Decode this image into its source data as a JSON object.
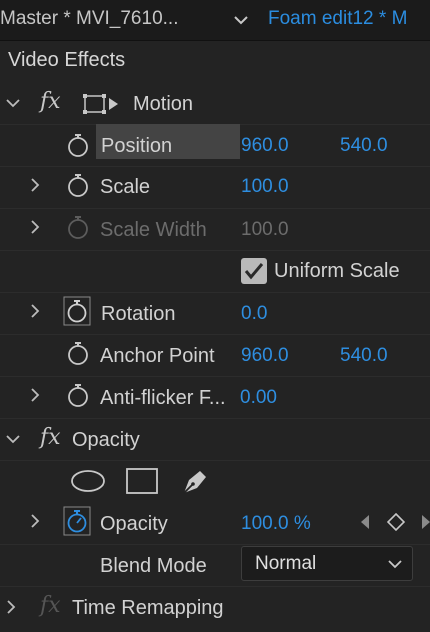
{
  "tabs": {
    "master": "Master * MVI_7610...",
    "sequence": "Foam edit12 * M"
  },
  "panel": {
    "section_title": "Video Effects"
  },
  "motion": {
    "name": "Motion",
    "fx_label": "fx",
    "position": {
      "label": "Position",
      "x": "960.0",
      "y": "540.0"
    },
    "scale": {
      "label": "Scale",
      "value": "100.0"
    },
    "scale_width": {
      "label": "Scale Width",
      "value": "100.0"
    },
    "uniform_scale": {
      "label": "Uniform Scale",
      "checked": true
    },
    "rotation": {
      "label": "Rotation",
      "value": "0.0"
    },
    "anchor_point": {
      "label": "Anchor Point",
      "x": "960.0",
      "y": "540.0"
    },
    "anti_flicker": {
      "label": "Anti-flicker F...",
      "value": "0.00"
    }
  },
  "opacity_effect": {
    "name": "Opacity",
    "fx_label": "fx",
    "mask_tools": [
      "ellipse-mask-icon",
      "rectangle-mask-icon",
      "pen-mask-icon"
    ],
    "opacity": {
      "label": "Opacity",
      "value": "100.0 %"
    },
    "blend_mode": {
      "label": "Blend Mode",
      "value": "Normal"
    }
  },
  "time_remapping": {
    "name": "Time Remapping",
    "fx_label": "fx"
  },
  "colors": {
    "accent_blue": "#2e8ee0",
    "panel_bg": "#232323"
  }
}
